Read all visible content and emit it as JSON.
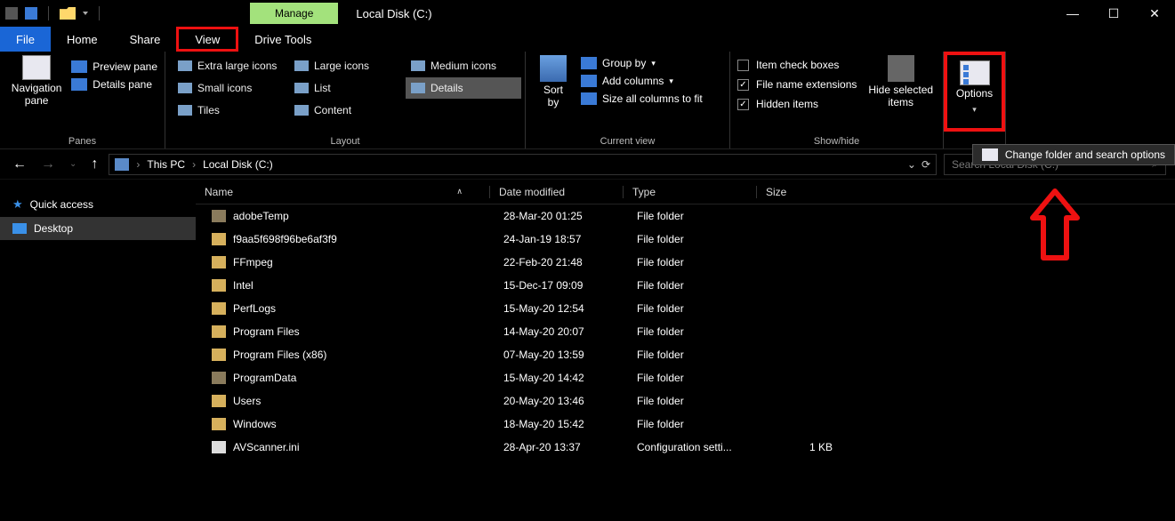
{
  "title": "Local Disk (C:)",
  "manage_tab": "Manage",
  "tabs": {
    "file": "File",
    "home": "Home",
    "share": "Share",
    "view": "View",
    "drive": "Drive Tools"
  },
  "ribbon": {
    "panes": {
      "nav": "Navigation\npane",
      "preview": "Preview pane",
      "details": "Details pane",
      "label": "Panes"
    },
    "layout": {
      "items": [
        "Extra large icons",
        "Large icons",
        "Medium icons",
        "Small icons",
        "List",
        "Details",
        "Tiles",
        "Content"
      ],
      "selected_index": 5,
      "label": "Layout"
    },
    "current_view": {
      "sort": "Sort\nby",
      "group": "Group by",
      "add_cols": "Add columns",
      "size_cols": "Size all columns to fit",
      "label": "Current view"
    },
    "show_hide": {
      "item_check": "Item check boxes",
      "file_ext": "File name extensions",
      "hidden": "Hidden items",
      "hide_selected": "Hide selected\nitems",
      "label": "Show/hide",
      "checked": {
        "item_check": false,
        "file_ext": true,
        "hidden": true
      }
    },
    "options": "Options",
    "options_dropdown": "Change folder and search options"
  },
  "breadcrumb": {
    "this_pc": "This PC",
    "local_disk": "Local Disk (C:)"
  },
  "search_placeholder": "Search Local Disk (C:)",
  "nav_tree": {
    "quick": "Quick access",
    "desktop": "Desktop"
  },
  "columns": {
    "name": "Name",
    "date": "Date modified",
    "type": "Type",
    "size": "Size"
  },
  "files": [
    {
      "name": "adobeTemp",
      "date": "28-Mar-20 01:25",
      "type": "File folder",
      "size": "",
      "icon": "folder-dim"
    },
    {
      "name": "f9aa5f698f96be6af3f9",
      "date": "24-Jan-19 18:57",
      "type": "File folder",
      "size": "",
      "icon": "folder"
    },
    {
      "name": "FFmpeg",
      "date": "22-Feb-20 21:48",
      "type": "File folder",
      "size": "",
      "icon": "folder"
    },
    {
      "name": "Intel",
      "date": "15-Dec-17 09:09",
      "type": "File folder",
      "size": "",
      "icon": "folder"
    },
    {
      "name": "PerfLogs",
      "date": "15-May-20 12:54",
      "type": "File folder",
      "size": "",
      "icon": "folder"
    },
    {
      "name": "Program Files",
      "date": "14-May-20 20:07",
      "type": "File folder",
      "size": "",
      "icon": "folder"
    },
    {
      "name": "Program Files (x86)",
      "date": "07-May-20 13:59",
      "type": "File folder",
      "size": "",
      "icon": "folder"
    },
    {
      "name": "ProgramData",
      "date": "15-May-20 14:42",
      "type": "File folder",
      "size": "",
      "icon": "folder-dim"
    },
    {
      "name": "Users",
      "date": "20-May-20 13:46",
      "type": "File folder",
      "size": "",
      "icon": "folder"
    },
    {
      "name": "Windows",
      "date": "18-May-20 15:42",
      "type": "File folder",
      "size": "",
      "icon": "folder"
    },
    {
      "name": "AVScanner.ini",
      "date": "28-Apr-20 13:37",
      "type": "Configuration setti...",
      "size": "1 KB",
      "icon": "file"
    }
  ]
}
